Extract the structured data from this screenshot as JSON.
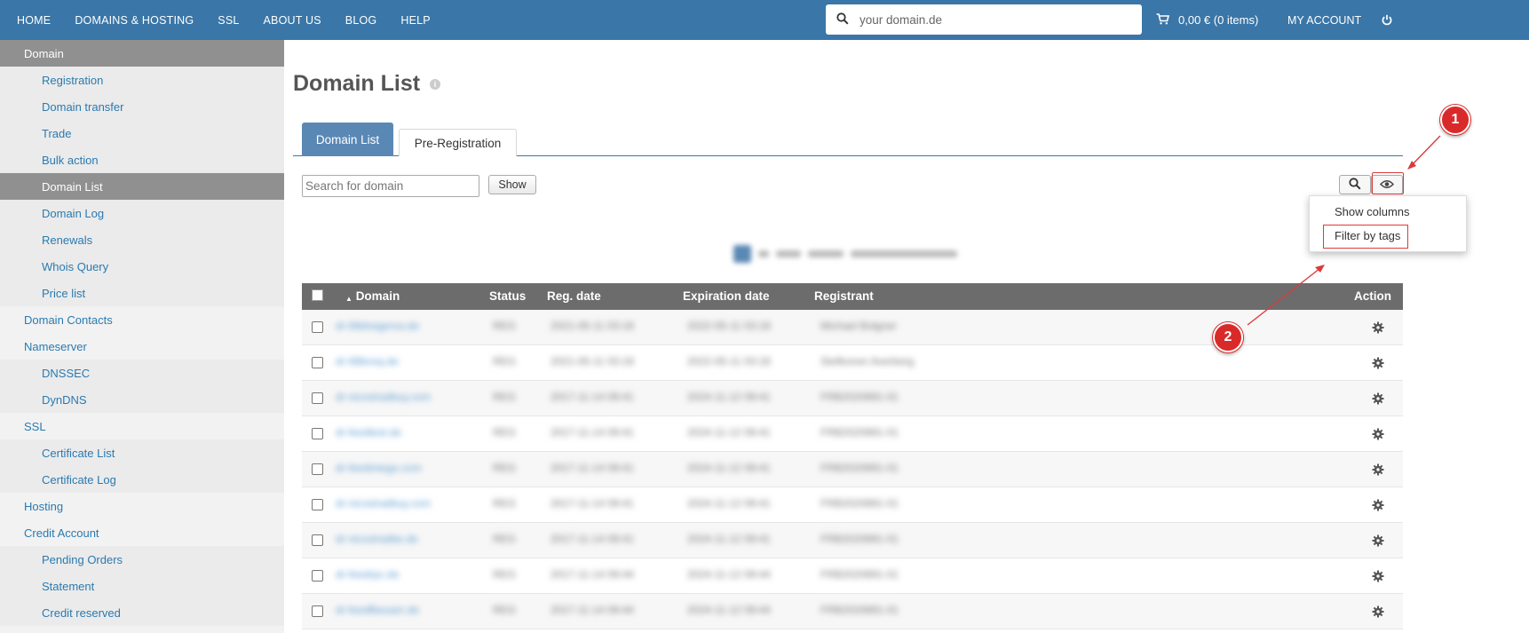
{
  "nav": {
    "items": [
      "HOME",
      "DOMAINS & HOSTING",
      "SSL",
      "ABOUT US",
      "BLOG",
      "HELP"
    ],
    "search_placeholder": "your domain.de",
    "cart_label": "0,00 € (0 items)",
    "account_label": "MY ACCOUNT"
  },
  "sidebar": {
    "domain": "Domain",
    "registration": "Registration",
    "domain_transfer": "Domain transfer",
    "trade": "Trade",
    "bulk_action": "Bulk action",
    "domain_list": "Domain List",
    "domain_log": "Domain Log",
    "renewals": "Renewals",
    "whois_query": "Whois Query",
    "price_list": "Price list",
    "domain_contacts": "Domain Contacts",
    "nameserver": "Nameserver",
    "dnssec": "DNSSEC",
    "dyndns": "DynDNS",
    "ssl": "SSL",
    "certificate_list": "Certificate List",
    "certificate_log": "Certificate Log",
    "hosting": "Hosting",
    "credit_account": "Credit Account",
    "pending_orders": "Pending Orders",
    "statement": "Statement",
    "credit_reserved": "Credit reserved"
  },
  "main": {
    "title": "Domain List",
    "tabs": [
      "Domain List",
      "Pre-Registration"
    ],
    "search_placeholder": "Search for domain",
    "show_label": "Show"
  },
  "dropdown": {
    "show_columns": "Show columns",
    "filter_by_tags": "Filter by tags"
  },
  "table": {
    "headers": {
      "domain": "Domain",
      "status": "Status",
      "reg_date": "Reg. date",
      "expiration_date": "Expiration date",
      "registrant": "Registrant",
      "action": "Action"
    },
    "rows": [
      {
        "domain": "dr-68drwgerva.de",
        "status": "REG",
        "reg": "2021-05-11 03:18",
        "exp": "2022-05-11 03:18",
        "registrant": "Michael Bolgner"
      },
      {
        "domain": "dr-68bnsq.de",
        "status": "REG",
        "reg": "2021-05-11 03:18",
        "exp": "2022-05-11 03:18",
        "registrant": "Stefkonen Averberg"
      },
      {
        "domain": "dr-nicoslradbuy.com",
        "status": "REG",
        "reg": "2017-11-14 09:41",
        "exp": "2024-11-12 09:41",
        "registrant": "FRB2020891-01"
      },
      {
        "domain": "dr-feedtest.de",
        "status": "REG",
        "reg": "2017-11-14 09:41",
        "exp": "2024-11-12 09:41",
        "registrant": "FRB2020891-01"
      },
      {
        "domain": "dr-feedmiego.com",
        "status": "REG",
        "reg": "2017-11-14 09:41",
        "exp": "2024-11-12 09:41",
        "registrant": "FRB2020891-01"
      },
      {
        "domain": "dr-nicoslradbuy.com",
        "status": "REG",
        "reg": "2017-11-14 09:41",
        "exp": "2024-11-12 09:41",
        "registrant": "FRB2020891-01"
      },
      {
        "domain": "dr-nicoslradbe.de",
        "status": "REG",
        "reg": "2017-11-14 09:41",
        "exp": "2024-11-12 09:41",
        "registrant": "FRB2020891-01"
      },
      {
        "domain": "dr-feedrpc.de",
        "status": "REG",
        "reg": "2017-11-14 09:44",
        "exp": "2024-11-12 09:44",
        "registrant": "FRB2020891-01"
      },
      {
        "domain": "dr-feedfbexam.de",
        "status": "REG",
        "reg": "2017-11-14 09:44",
        "exp": "2024-11-12 09:44",
        "registrant": "FRB2020891-01"
      }
    ]
  },
  "annotations": [
    "1",
    "2"
  ]
}
